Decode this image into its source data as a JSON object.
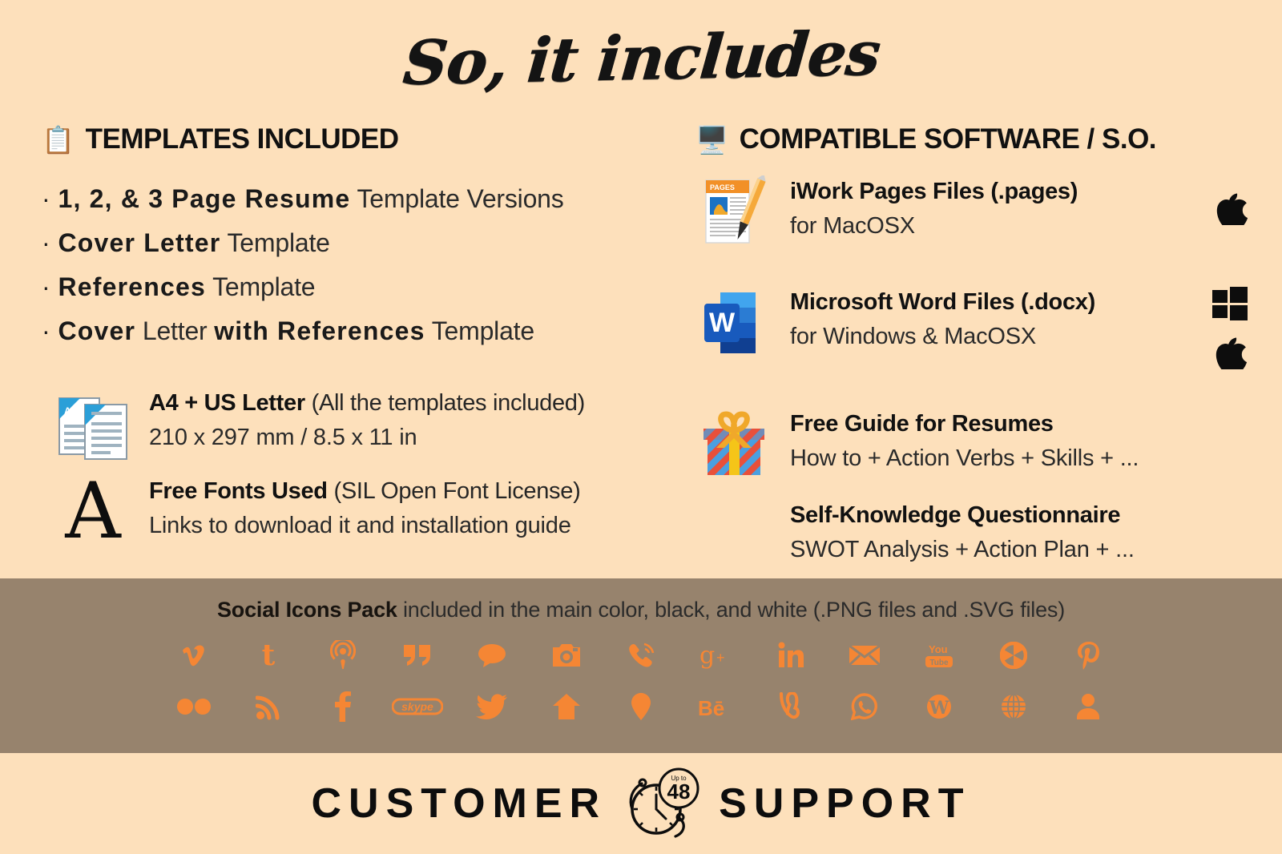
{
  "title": "So, it includes",
  "left": {
    "heading": {
      "icon": "clipboard-icon",
      "label": "TEMPLATES INCLUDED"
    },
    "bullets": [
      {
        "bold": "1, 2, & 3 Page Resume",
        "rest": " Template Versions"
      },
      {
        "bold": "Cover Letter",
        "rest": " Template"
      },
      {
        "bold": "References",
        "rest": " Template"
      },
      {
        "bold": "Cover",
        "mid": " Letter ",
        "bold2": "with References",
        "rest": " Template"
      }
    ],
    "features": [
      {
        "icon": "documents-a4-icon",
        "title_bold": "A4 + US Letter",
        "title_rest": " (All the templates included)",
        "sub": "210 x 297 mm / 8.5 x 11 in"
      },
      {
        "icon": "letter-a-icon",
        "title_bold": "Free Fonts Used",
        "title_rest": " (SIL Open Font License)",
        "sub": "Links to download it and installation guide"
      }
    ]
  },
  "right": {
    "heading": {
      "icon": "desktop-computer-icon",
      "label": "COMPATIBLE SOFTWARE / S.O."
    },
    "software": [
      {
        "icon": "apple-pages-icon",
        "title": "iWork Pages Files (.pages)",
        "sub": "for MacOSX",
        "os": [
          "apple-logo-icon"
        ]
      },
      {
        "icon": "microsoft-word-icon",
        "title": "Microsoft Word Files (.docx)",
        "sub": "for Windows & MacOSX",
        "os": [
          "windows-logo-icon",
          "apple-logo-icon"
        ]
      }
    ],
    "extras": [
      {
        "icon": "gift-box-icon",
        "title": "Free Guide for Resumes",
        "sub": "How to + Action Verbs + Skills + ..."
      },
      {
        "icon": "none",
        "title": "Self-Knowledge Questionnaire",
        "sub": "SWOT Analysis + Action Plan + ..."
      }
    ]
  },
  "banner": {
    "bold": "Social Icons Pack",
    "rest": " included in the main color, black, and white (.PNG files and .SVG files)",
    "row1": [
      "vimeo-icon",
      "tumblr-icon",
      "podcast-icon",
      "quote-icon",
      "chat-bubble-icon",
      "instagram-icon",
      "phone-ring-icon",
      "google-plus-icon",
      "linkedin-icon",
      "email-icon",
      "youtube-icon",
      "aperture-icon",
      "pinterest-icon"
    ],
    "row2": [
      "flickr-icon",
      "rss-icon",
      "facebook-icon",
      "skype-icon",
      "twitter-icon",
      "home-icon",
      "location-pin-icon",
      "behance-icon",
      "vine-icon",
      "whatsapp-icon",
      "wordpress-icon",
      "globe-icon",
      "person-icon"
    ]
  },
  "footer": {
    "left_word": "CUSTOMER",
    "right_word": "SUPPORT",
    "clock": {
      "small": "Up to",
      "number": "48"
    }
  },
  "colors": {
    "background": "#fde0bb",
    "banner": "#97836d",
    "accent_orange": "#f58634",
    "text": "#111111"
  }
}
